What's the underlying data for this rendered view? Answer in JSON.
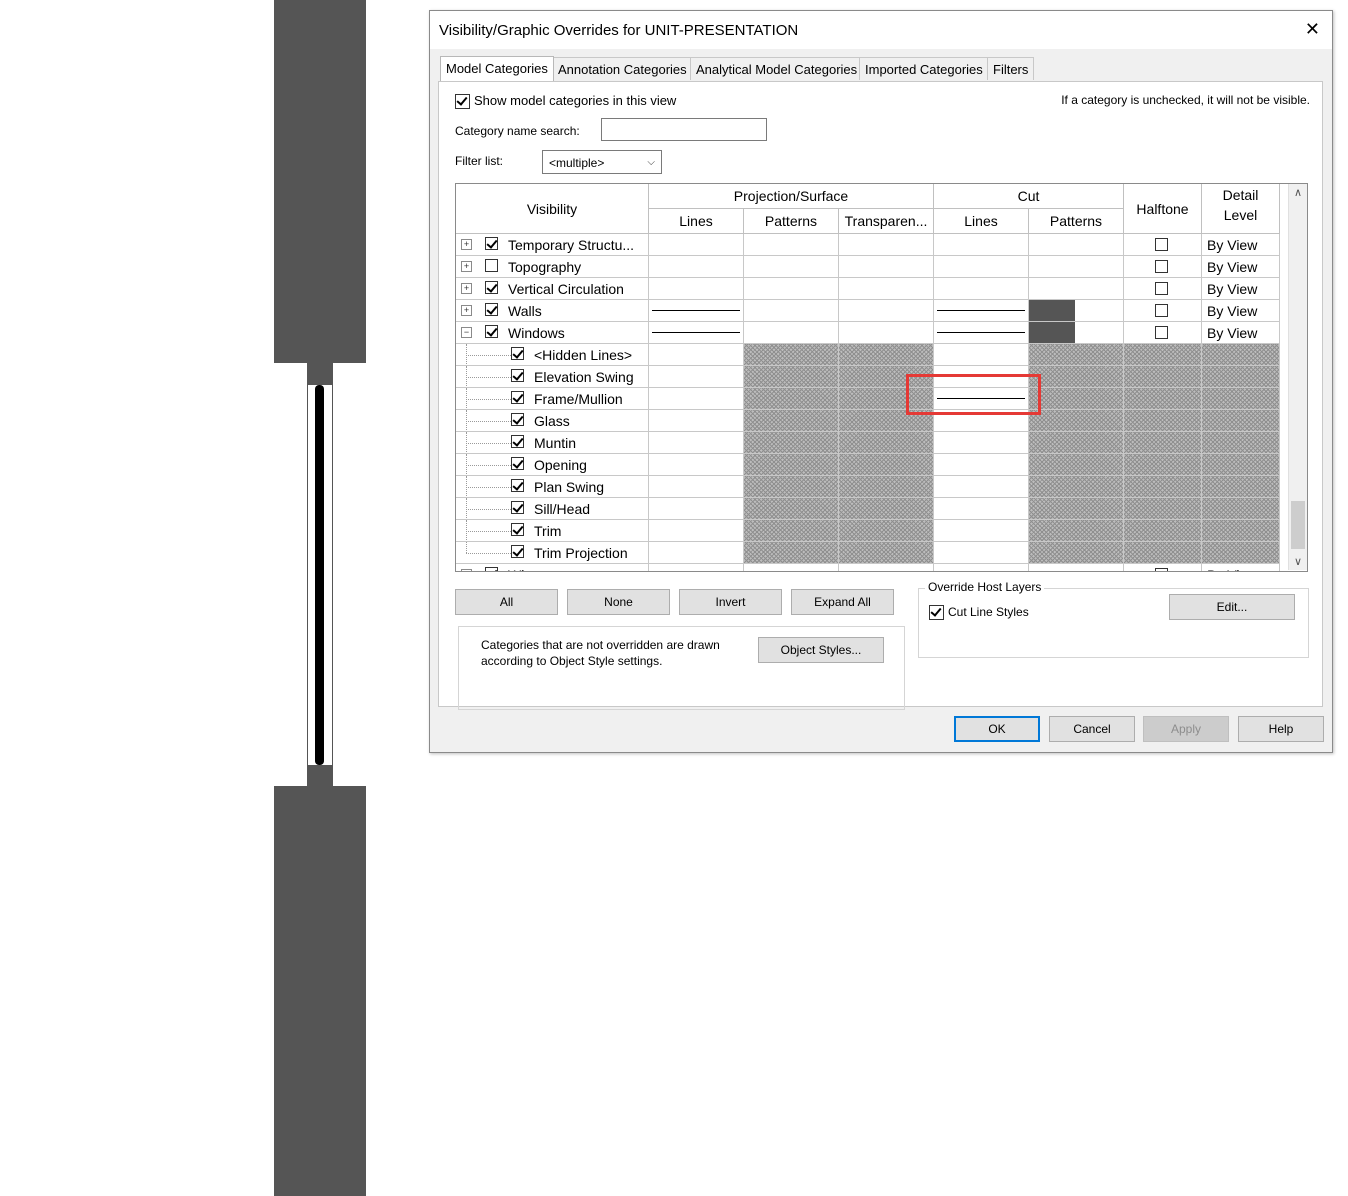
{
  "dialog": {
    "title": "Visibility/Graphic Overrides for UNIT-PRESENTATION",
    "close_glyph": "✕",
    "tabs": [
      "Model Categories",
      "Annotation Categories",
      "Analytical Model Categories",
      "Imported Categories",
      "Filters"
    ],
    "active_tab": "Model Categories",
    "show_label": "Show model categories in this view",
    "show_checked": true,
    "hint": "If a category is unchecked, it will not be visible.",
    "search_label": "Category name search:",
    "search_value": "",
    "filter_label": "Filter list:",
    "filter_value": "<multiple>"
  },
  "grid": {
    "headers": {
      "visibility": "Visibility",
      "projection": "Projection/Surface",
      "cut": "Cut",
      "halftone": "Halftone",
      "detail": "Detail Level",
      "lines": "Lines",
      "patterns": "Patterns",
      "transparency": "Transparen...",
      "cut_lines": "Lines",
      "cut_patterns": "Patterns"
    },
    "rows": [
      {
        "name": "Temporary Structu...",
        "checked": true,
        "level": 0,
        "expander": "+",
        "detail": "By View"
      },
      {
        "name": "Topography",
        "checked": false,
        "level": 0,
        "expander": "+",
        "detail": "By View"
      },
      {
        "name": "Vertical Circulation",
        "checked": true,
        "level": 0,
        "expander": "+",
        "detail": "By View"
      },
      {
        "name": "Walls",
        "checked": true,
        "level": 0,
        "expander": "+",
        "detail": "By View"
      },
      {
        "name": "Windows",
        "checked": true,
        "level": 0,
        "expander": "−",
        "detail": "By View"
      },
      {
        "name": "<Hidden Lines>",
        "checked": true,
        "level": 1
      },
      {
        "name": "Elevation Swing",
        "checked": true,
        "level": 1
      },
      {
        "name": "Frame/Mullion",
        "checked": true,
        "level": 1
      },
      {
        "name": "Glass",
        "checked": true,
        "level": 1
      },
      {
        "name": "Muntin",
        "checked": true,
        "level": 1
      },
      {
        "name": "Opening",
        "checked": true,
        "level": 1
      },
      {
        "name": "Plan Swing",
        "checked": true,
        "level": 1
      },
      {
        "name": "Sill/Head",
        "checked": true,
        "level": 1
      },
      {
        "name": "Trim",
        "checked": true,
        "level": 1
      },
      {
        "name": "Trim Projection",
        "checked": true,
        "level": 1
      },
      {
        "name": "Wi...",
        "checked": true,
        "level": 0,
        "expander": "+",
        "detail": "By Vi..."
      }
    ]
  },
  "buttons": {
    "all": "All",
    "none": "None",
    "invert": "Invert",
    "expand_all": "Expand All",
    "object_styles": "Object Styles...",
    "edit": "Edit...",
    "ok": "OK",
    "cancel": "Cancel",
    "apply": "Apply",
    "help": "Help"
  },
  "notes": {
    "line1": "Categories that are not overridden are drawn",
    "line2": "according to Object Style settings."
  },
  "override_host": {
    "title": "Override Host Layers",
    "cut_line_label": "Cut Line Styles",
    "cut_line_checked": true
  }
}
